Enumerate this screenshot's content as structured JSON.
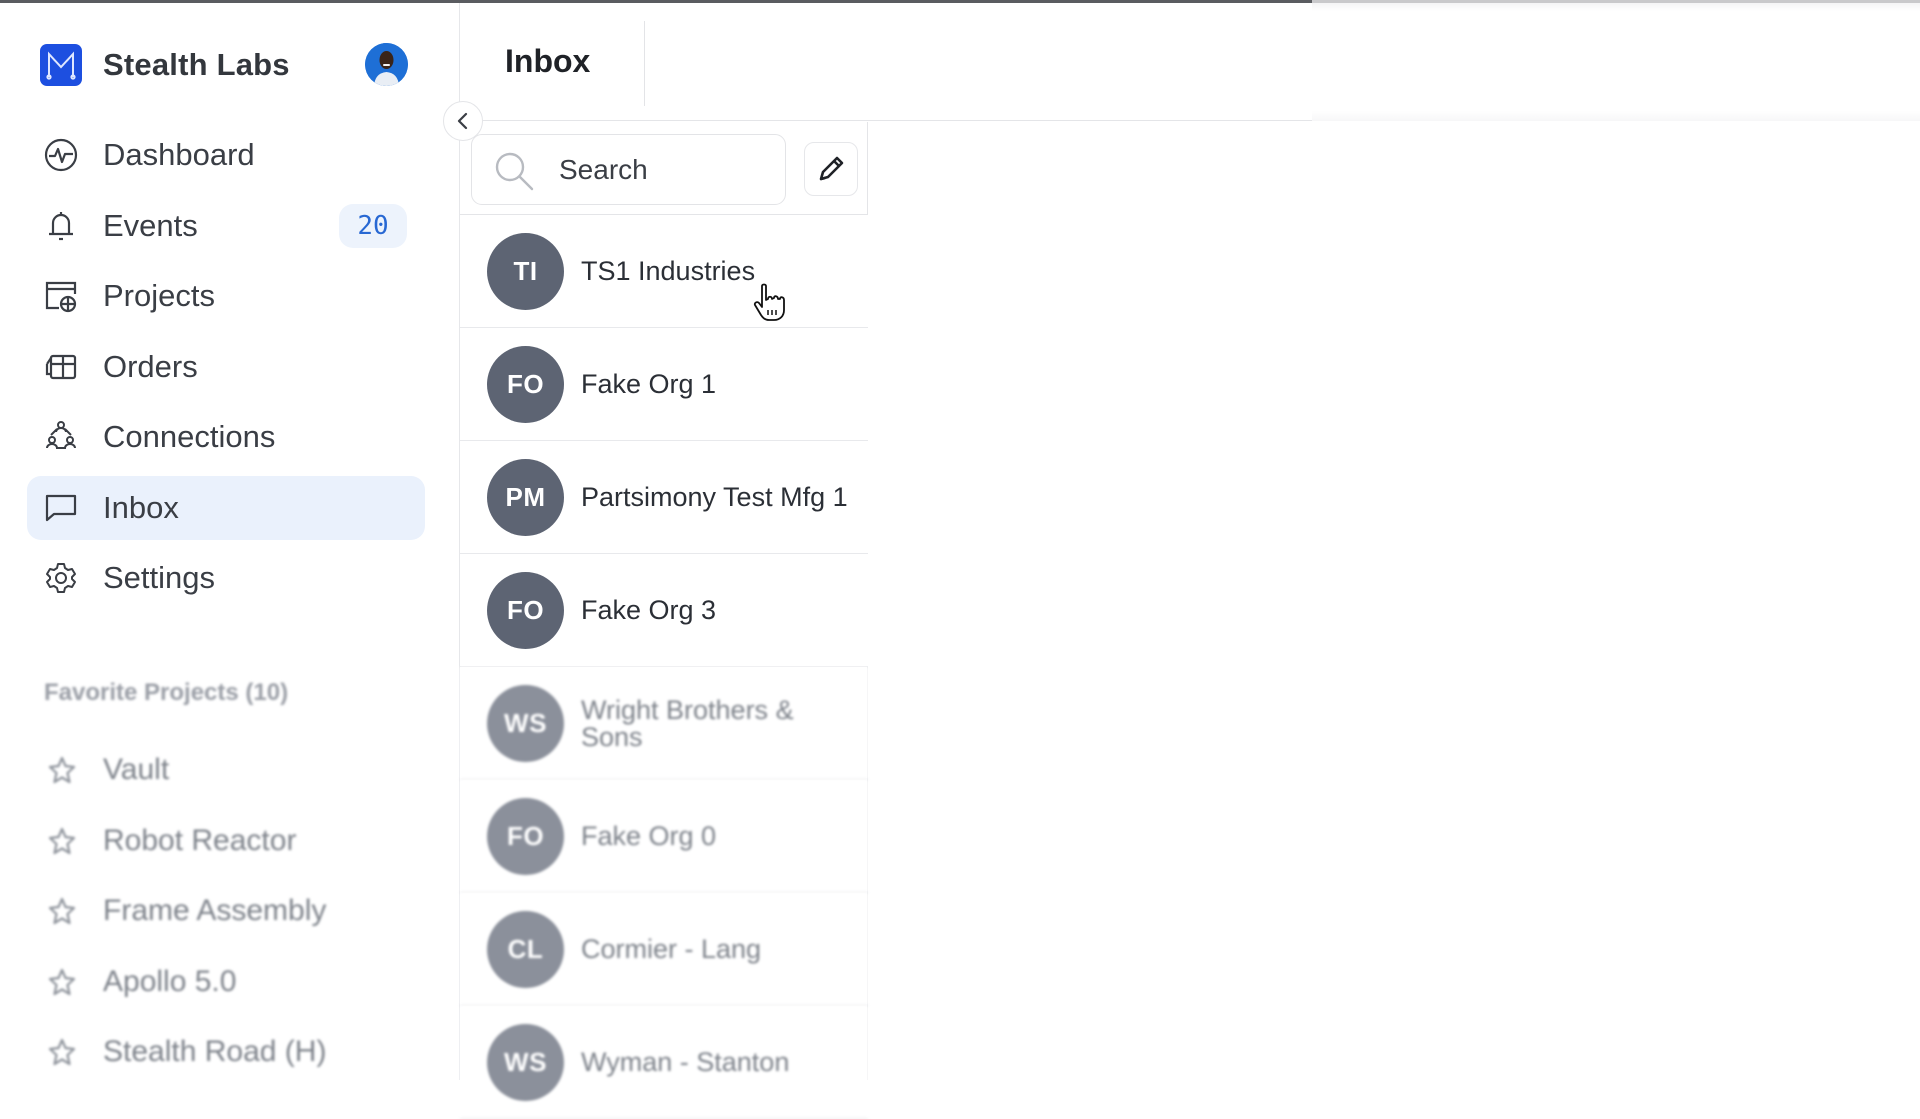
{
  "brand": {
    "name": "Stealth Labs",
    "logo_icon": "m-logo-icon",
    "logo_color": "#1d4fe0"
  },
  "user": {
    "avatar_icon": "user-photo-avatar"
  },
  "nav": {
    "items": [
      {
        "label": "Dashboard",
        "icon": "activity-pulse-icon"
      },
      {
        "label": "Events",
        "icon": "bell-icon",
        "badge": "20"
      },
      {
        "label": "Projects",
        "icon": "projects-box-icon"
      },
      {
        "label": "Orders",
        "icon": "orders-icon"
      },
      {
        "label": "Connections",
        "icon": "people-network-icon"
      },
      {
        "label": "Inbox",
        "icon": "chat-bubble-icon",
        "active": true
      },
      {
        "label": "Settings",
        "icon": "gear-icon"
      }
    ]
  },
  "favorites": {
    "title": "Favorite Projects (10)",
    "items": [
      {
        "label": "Vault"
      },
      {
        "label": "Robot Reactor"
      },
      {
        "label": "Frame Assembly"
      },
      {
        "label": "Apollo 5.0"
      },
      {
        "label": "Stealth Road (H)"
      }
    ]
  },
  "header": {
    "title": "Inbox"
  },
  "search": {
    "placeholder": "Search",
    "value": ""
  },
  "conversations": [
    {
      "initials": "TI",
      "name": "TS1 Industries"
    },
    {
      "initials": "FO",
      "name": "Fake Org 1"
    },
    {
      "initials": "PM",
      "name": "Partsimony Test Mfg 1"
    },
    {
      "initials": "FO",
      "name": "Fake Org 3"
    },
    {
      "initials": "WS",
      "name": "Wright Brothers & Sons"
    },
    {
      "initials": "FO",
      "name": "Fake Org 0"
    },
    {
      "initials": "CL",
      "name": "Cormier - Lang"
    },
    {
      "initials": "WS",
      "name": "Wyman - Stanton"
    }
  ],
  "colors": {
    "accent": "#2868d3",
    "active_bg": "#eaf1fc",
    "avatar_bg": "#5d6473"
  }
}
